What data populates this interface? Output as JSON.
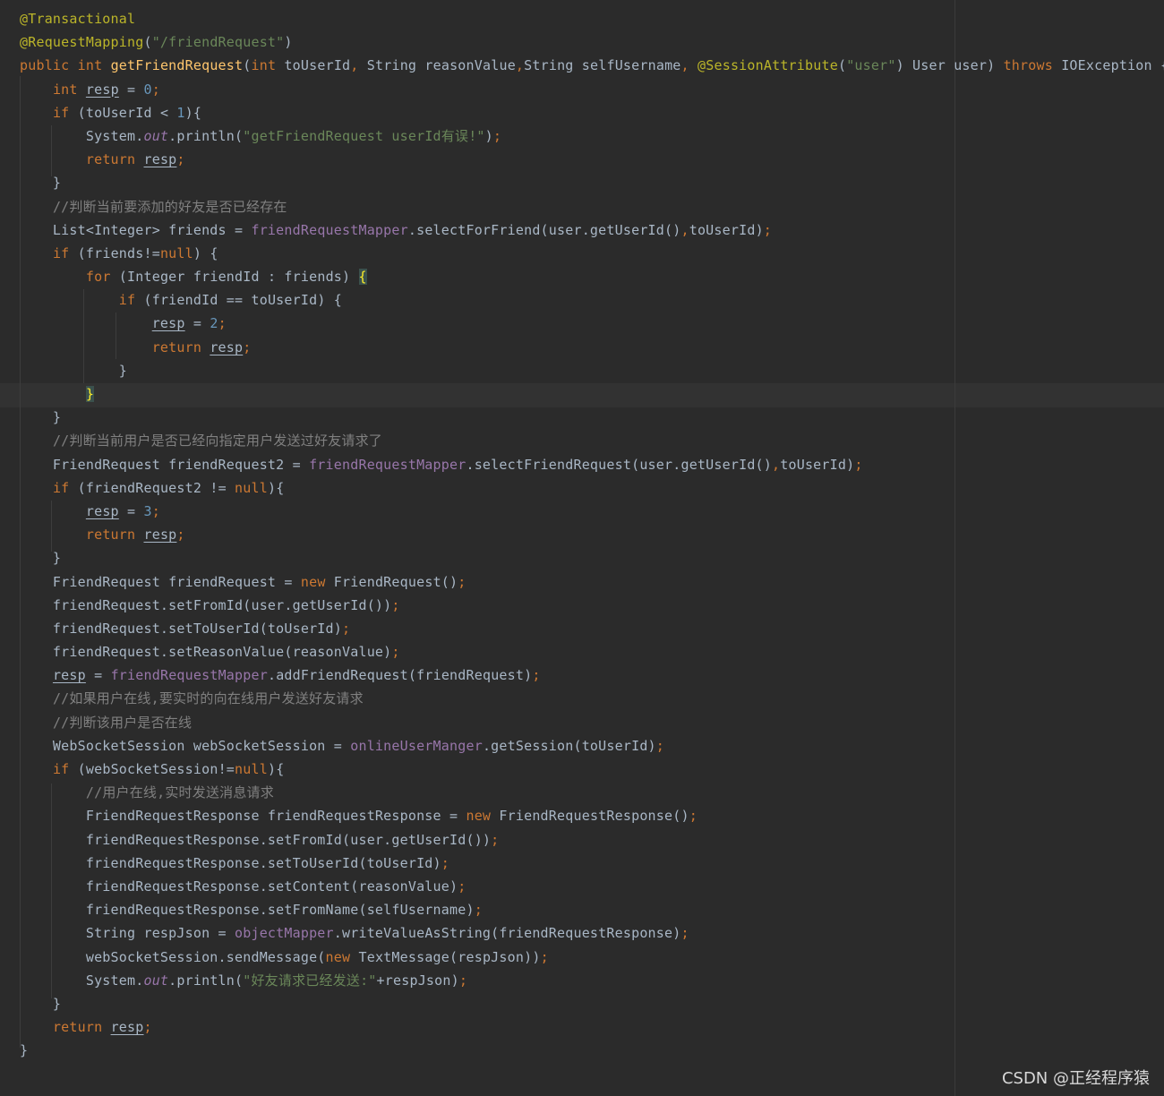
{
  "editor": {
    "lines": [
      [
        {
          "t": "@Transactional",
          "c": "ann"
        }
      ],
      [
        {
          "t": "@RequestMapping",
          "c": "ann"
        },
        {
          "t": "(",
          "c": "plain"
        },
        {
          "t": "\"/friendRequest\"",
          "c": "str"
        },
        {
          "t": ")",
          "c": "plain"
        }
      ],
      [
        {
          "t": "public ",
          "c": "kw"
        },
        {
          "t": "int ",
          "c": "kw"
        },
        {
          "t": "getFriendRequest",
          "c": "mdecl"
        },
        {
          "t": "(",
          "c": "plain"
        },
        {
          "t": "int ",
          "c": "kw"
        },
        {
          "t": "toUserId",
          "c": "plain"
        },
        {
          "t": ", ",
          "c": "punc"
        },
        {
          "t": "String reasonValue",
          "c": "plain"
        },
        {
          "t": ",",
          "c": "punc"
        },
        {
          "t": "String selfUsername",
          "c": "plain"
        },
        {
          "t": ", ",
          "c": "punc"
        },
        {
          "t": "@SessionAttribute",
          "c": "ann"
        },
        {
          "t": "(",
          "c": "plain"
        },
        {
          "t": "\"user\"",
          "c": "str"
        },
        {
          "t": ") User user) ",
          "c": "plain"
        },
        {
          "t": "throws ",
          "c": "kw"
        },
        {
          "t": "IOException {",
          "c": "plain"
        }
      ],
      [
        {
          "t": "    ",
          "c": "plain"
        },
        {
          "t": "int ",
          "c": "kw"
        },
        {
          "t": "resp",
          "c": "var-u"
        },
        {
          "t": " = ",
          "c": "plain"
        },
        {
          "t": "0",
          "c": "num"
        },
        {
          "t": ";",
          "c": "punc"
        }
      ],
      [
        {
          "t": "    ",
          "c": "plain"
        },
        {
          "t": "if ",
          "c": "kw"
        },
        {
          "t": "(toUserId < ",
          "c": "plain"
        },
        {
          "t": "1",
          "c": "num"
        },
        {
          "t": "){",
          "c": "plain"
        }
      ],
      [
        {
          "t": "        System.",
          "c": "plain"
        },
        {
          "t": "out",
          "c": "sfld"
        },
        {
          "t": ".println(",
          "c": "plain"
        },
        {
          "t": "\"getFriendRequest userId有误!\"",
          "c": "str"
        },
        {
          "t": ")",
          "c": "plain"
        },
        {
          "t": ";",
          "c": "punc"
        }
      ],
      [
        {
          "t": "        ",
          "c": "plain"
        },
        {
          "t": "return ",
          "c": "kw"
        },
        {
          "t": "resp",
          "c": "var-u"
        },
        {
          "t": ";",
          "c": "punc"
        }
      ],
      [
        {
          "t": "    }",
          "c": "plain"
        }
      ],
      [
        {
          "t": "    ",
          "c": "plain"
        },
        {
          "t": "//判断当前要添加的好友是否已经存在",
          "c": "cmt"
        }
      ],
      [
        {
          "t": "    List<Integer> friends = ",
          "c": "plain"
        },
        {
          "t": "friendRequestMapper",
          "c": "fld"
        },
        {
          "t": ".selectForFriend(user.getUserId()",
          "c": "plain"
        },
        {
          "t": ",",
          "c": "punc"
        },
        {
          "t": "toUserId)",
          "c": "plain"
        },
        {
          "t": ";",
          "c": "punc"
        }
      ],
      [
        {
          "t": "    ",
          "c": "plain"
        },
        {
          "t": "if ",
          "c": "kw"
        },
        {
          "t": "(friends!=",
          "c": "plain"
        },
        {
          "t": "null",
          "c": "kw"
        },
        {
          "t": ") {",
          "c": "plain"
        }
      ],
      [
        {
          "t": "        ",
          "c": "plain"
        },
        {
          "t": "for ",
          "c": "kw"
        },
        {
          "t": "(Integer friendId : friends) ",
          "c": "plain"
        },
        {
          "t": "{",
          "c": "brace-hl"
        }
      ],
      [
        {
          "t": "            ",
          "c": "plain"
        },
        {
          "t": "if ",
          "c": "kw"
        },
        {
          "t": "(friendId == toUserId) {",
          "c": "plain"
        }
      ],
      [
        {
          "t": "                ",
          "c": "plain"
        },
        {
          "t": "resp",
          "c": "var-u"
        },
        {
          "t": " = ",
          "c": "plain"
        },
        {
          "t": "2",
          "c": "num"
        },
        {
          "t": ";",
          "c": "punc"
        }
      ],
      [
        {
          "t": "                ",
          "c": "plain"
        },
        {
          "t": "return ",
          "c": "kw"
        },
        {
          "t": "resp",
          "c": "var-u"
        },
        {
          "t": ";",
          "c": "punc"
        }
      ],
      [
        {
          "t": "            }",
          "c": "plain"
        }
      ],
      [
        {
          "t": "        ",
          "c": "plain"
        },
        {
          "t": "}",
          "c": "brace-hl"
        }
      ],
      [
        {
          "t": "    }",
          "c": "plain"
        }
      ],
      [
        {
          "t": "    ",
          "c": "plain"
        },
        {
          "t": "//判断当前用户是否已经向指定用户发送过好友请求了",
          "c": "cmt"
        }
      ],
      [
        {
          "t": "    FriendRequest friendRequest2 = ",
          "c": "plain"
        },
        {
          "t": "friendRequestMapper",
          "c": "fld"
        },
        {
          "t": ".selectFriendRequest(user.getUserId()",
          "c": "plain"
        },
        {
          "t": ",",
          "c": "punc"
        },
        {
          "t": "toUserId)",
          "c": "plain"
        },
        {
          "t": ";",
          "c": "punc"
        }
      ],
      [
        {
          "t": "    ",
          "c": "plain"
        },
        {
          "t": "if ",
          "c": "kw"
        },
        {
          "t": "(friendRequest2 != ",
          "c": "plain"
        },
        {
          "t": "null",
          "c": "kw"
        },
        {
          "t": "){",
          "c": "plain"
        }
      ],
      [
        {
          "t": "        ",
          "c": "plain"
        },
        {
          "t": "resp",
          "c": "var-u"
        },
        {
          "t": " = ",
          "c": "plain"
        },
        {
          "t": "3",
          "c": "num"
        },
        {
          "t": ";",
          "c": "punc"
        }
      ],
      [
        {
          "t": "        ",
          "c": "plain"
        },
        {
          "t": "return ",
          "c": "kw"
        },
        {
          "t": "resp",
          "c": "var-u"
        },
        {
          "t": ";",
          "c": "punc"
        }
      ],
      [
        {
          "t": "    }",
          "c": "plain"
        }
      ],
      [
        {
          "t": "    FriendRequest friendRequest = ",
          "c": "plain"
        },
        {
          "t": "new ",
          "c": "kw"
        },
        {
          "t": "FriendRequest()",
          "c": "plain"
        },
        {
          "t": ";",
          "c": "punc"
        }
      ],
      [
        {
          "t": "    friendRequest.setFromId(user.getUserId())",
          "c": "plain"
        },
        {
          "t": ";",
          "c": "punc"
        }
      ],
      [
        {
          "t": "    friendRequest.setToUserId(toUserId)",
          "c": "plain"
        },
        {
          "t": ";",
          "c": "punc"
        }
      ],
      [
        {
          "t": "    friendRequest.setReasonValue(reasonValue)",
          "c": "plain"
        },
        {
          "t": ";",
          "c": "punc"
        }
      ],
      [
        {
          "t": "    ",
          "c": "plain"
        },
        {
          "t": "resp",
          "c": "var-u"
        },
        {
          "t": " = ",
          "c": "plain"
        },
        {
          "t": "friendRequestMapper",
          "c": "fld"
        },
        {
          "t": ".addFriendRequest(friendRequest)",
          "c": "plain"
        },
        {
          "t": ";",
          "c": "punc"
        }
      ],
      [
        {
          "t": "    ",
          "c": "plain"
        },
        {
          "t": "//如果用户在线,要实时的向在线用户发送好友请求",
          "c": "cmt"
        }
      ],
      [
        {
          "t": "    ",
          "c": "plain"
        },
        {
          "t": "//判断该用户是否在线",
          "c": "cmt"
        }
      ],
      [
        {
          "t": "    WebSocketSession webSocketSession = ",
          "c": "plain"
        },
        {
          "t": "onlineUserManger",
          "c": "fld"
        },
        {
          "t": ".getSession(toUserId)",
          "c": "plain"
        },
        {
          "t": ";",
          "c": "punc"
        }
      ],
      [
        {
          "t": "    ",
          "c": "plain"
        },
        {
          "t": "if ",
          "c": "kw"
        },
        {
          "t": "(webSocketSession!=",
          "c": "plain"
        },
        {
          "t": "null",
          "c": "kw"
        },
        {
          "t": "){",
          "c": "plain"
        }
      ],
      [
        {
          "t": "        ",
          "c": "plain"
        },
        {
          "t": "//用户在线,实时发送消息请求",
          "c": "cmt"
        }
      ],
      [
        {
          "t": "        FriendRequestResponse friendRequestResponse = ",
          "c": "plain"
        },
        {
          "t": "new ",
          "c": "kw"
        },
        {
          "t": "FriendRequestResponse()",
          "c": "plain"
        },
        {
          "t": ";",
          "c": "punc"
        }
      ],
      [
        {
          "t": "        friendRequestResponse.setFromId(user.getUserId())",
          "c": "plain"
        },
        {
          "t": ";",
          "c": "punc"
        }
      ],
      [
        {
          "t": "        friendRequestResponse.setToUserId(toUserId)",
          "c": "plain"
        },
        {
          "t": ";",
          "c": "punc"
        }
      ],
      [
        {
          "t": "        friendRequestResponse.setContent(reasonValue)",
          "c": "plain"
        },
        {
          "t": ";",
          "c": "punc"
        }
      ],
      [
        {
          "t": "        friendRequestResponse.setFromName(selfUsername)",
          "c": "plain"
        },
        {
          "t": ";",
          "c": "punc"
        }
      ],
      [
        {
          "t": "        String respJson = ",
          "c": "plain"
        },
        {
          "t": "objectMapper",
          "c": "fld"
        },
        {
          "t": ".writeValueAsString(friendRequestResponse)",
          "c": "plain"
        },
        {
          "t": ";",
          "c": "punc"
        }
      ],
      [
        {
          "t": "        webSocketSession.sendMessage(",
          "c": "plain"
        },
        {
          "t": "new ",
          "c": "kw"
        },
        {
          "t": "TextMessage(respJson))",
          "c": "plain"
        },
        {
          "t": ";",
          "c": "punc"
        }
      ],
      [
        {
          "t": "        System.",
          "c": "plain"
        },
        {
          "t": "out",
          "c": "sfld"
        },
        {
          "t": ".println(",
          "c": "plain"
        },
        {
          "t": "\"好友请求已经发送:\"",
          "c": "str"
        },
        {
          "t": "+respJson)",
          "c": "plain"
        },
        {
          "t": ";",
          "c": "punc"
        }
      ],
      [
        {
          "t": "    }",
          "c": "plain"
        }
      ],
      [
        {
          "t": "    ",
          "c": "plain"
        },
        {
          "t": "return ",
          "c": "kw"
        },
        {
          "t": "resp",
          "c": "var-u"
        },
        {
          "t": ";",
          "c": "punc"
        }
      ],
      [
        {
          "t": "}",
          "c": "plain"
        }
      ]
    ]
  },
  "watermark": {
    "text": "CSDN @正经程序猿"
  },
  "colors": {
    "background": "#2b2b2b",
    "keyword": "#cc7832",
    "annotation": "#bbb529",
    "string": "#6a8759",
    "number": "#6897bb",
    "comment": "#808080",
    "field": "#9876aa",
    "method_declaration": "#ffc66d",
    "text": "#a9b7c6"
  }
}
